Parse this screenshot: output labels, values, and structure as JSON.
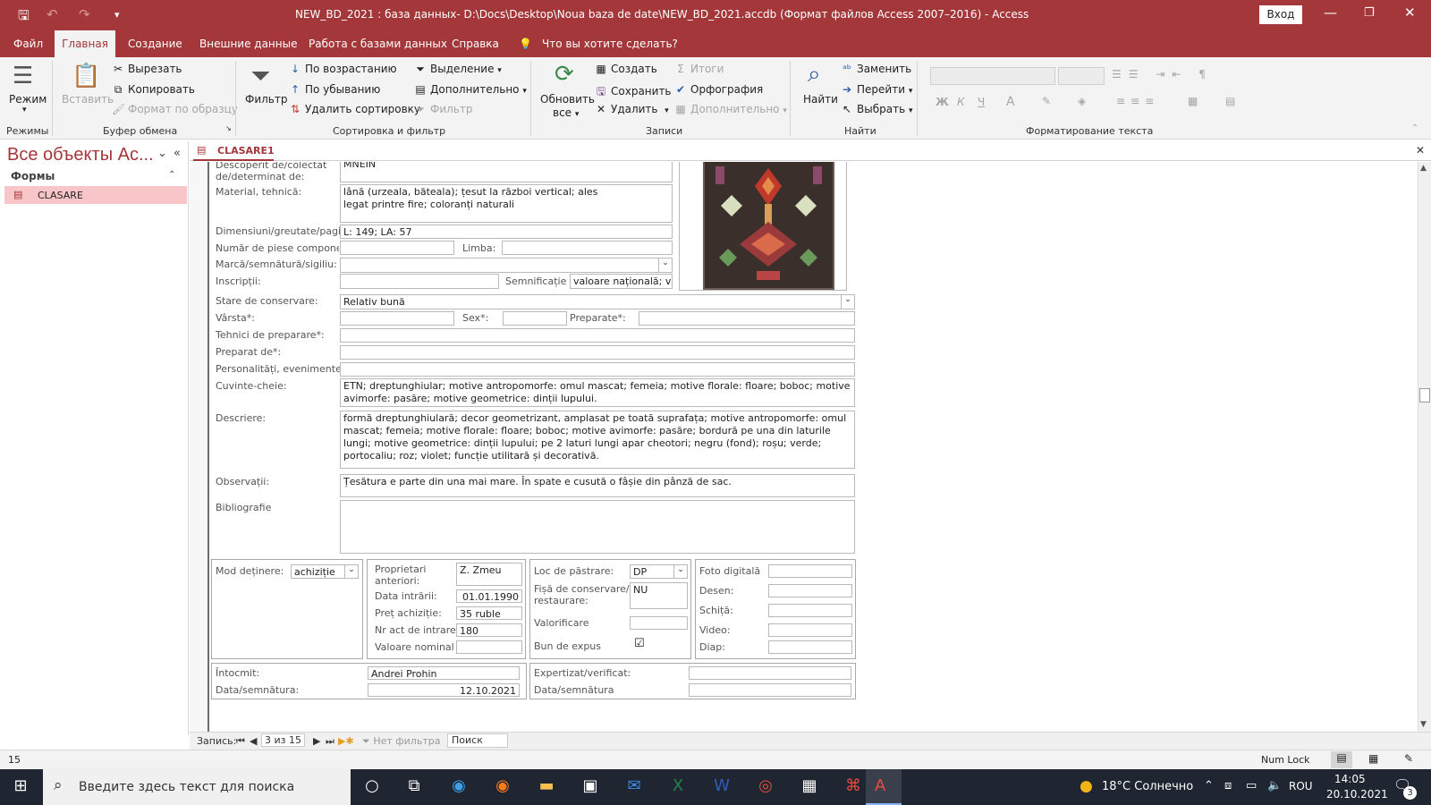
{
  "titlebar": {
    "title": "NEW_BD_2021 : база данных- D:\\Docs\\Desktop\\Noua baza de date\\NEW_BD_2021.accdb (Формат файлов Access 2007–2016)  -  Access",
    "login_label": "Вход"
  },
  "menu": {
    "tabs": [
      "Файл",
      "Главная",
      "Создание",
      "Внешние данные",
      "Работа с базами данных",
      "Справка"
    ],
    "tell_me": "Что вы хотите сделать?"
  },
  "ribbon": {
    "views": {
      "mode": "Режим",
      "group": "Режимы"
    },
    "clipboard": {
      "paste": "Вставить",
      "cut": "Вырезать",
      "copy": "Копировать",
      "format_painter": "Формат по образцу",
      "group": "Буфер обмена"
    },
    "sort_filter": {
      "filter": "Фильтр",
      "ascending": "По возрастанию",
      "descending": "По убыванию",
      "remove_sort": "Удалить сортировку",
      "selection": "Выделение",
      "advanced": "Дополнительно",
      "toggle_filter": "Фильтр",
      "group": "Сортировка и фильтр"
    },
    "records": {
      "refresh": "Обновить",
      "refresh2": "все",
      "new": "Создать",
      "save": "Сохранить",
      "delete": "Удалить",
      "totals": "Итоги",
      "spelling": "Орфография",
      "more": "Дополнительно",
      "group": "Записи"
    },
    "find": {
      "find": "Найти",
      "replace": "Заменить",
      "goto": "Перейти",
      "select": "Выбрать",
      "group": "Найти"
    },
    "text_format": {
      "group": "Форматирование текста"
    }
  },
  "nav": {
    "title": "Все объекты Ac...",
    "group": "Формы",
    "item": "CLASARE"
  },
  "doc": {
    "tab": "CLASARE1"
  },
  "form": {
    "descoperit_label": "Descoperit de/colectat de/determinat de:",
    "descoperit_value": "MNEIN",
    "material_label": "Material, tehnică:",
    "material_value": "lână (urzeala, băteala); țesut la război vertical; ales legat printre fire; coloranți naturali",
    "dimensiuni_label": "Dimensiuni/greutate/pagi",
    "dimensiuni_value": "L: 149; LA: 57",
    "numar_label": "Număr de piese componer",
    "limba_label": "Limba:",
    "marca_label": "Marcă/semnătură/sigiliu:",
    "inscriptii_label": "Inscripții:",
    "semnificatie_label": "Semnificație",
    "semnificatie_value": "valoare națională; va",
    "stare_label": "Stare de conservare:",
    "stare_value": "Relativ bună",
    "varsta_label": "Vârsta*:",
    "sex_label": "Sex*:",
    "preparate_label": "Preparate*:",
    "tehnici_label": "Tehnici de preparare*:",
    "preparat_label": "Preparat de*:",
    "personalitati_label": "Personalități, evenimente",
    "cuvinte_label": "Cuvinte-cheie:",
    "cuvinte_value": "ETN; dreptunghiular; motive antropomorfe: omul mascat; femeia; motive florale: floare; boboc; motive avimorfe: pasăre; motive geometrice: dinții lupului.",
    "descriere_label": "Descriere:",
    "descriere_value": "formă dreptunghiulară; decor geometrizant, amplasat pe toată suprafața; motive antropomorfe: omul mascat; femeia; motive florale: floare; boboc; motive avimorfe: pasăre; bordură pe una din laturile lungi; motive geometrice: dinții lupului; pe 2 laturi lungi apar cheotori; negru (fond); roșu; verde; portocaliu; roz; violet; funcție utilitară și decorativă.",
    "observatii_label": "Observații:",
    "observatii_value": "Țesătura e parte din una mai mare. În spate e cusută o fâșie din pânză de sac.",
    "bibliografie_label": "Bibliografie",
    "mod_label": "Mod deținere:",
    "mod_value": "achiziție",
    "proprietari_label": "Proprietari anteriori:",
    "proprietari_value": "Z. Zmeu",
    "data_intrarii_label": "Data intrării:",
    "data_intrarii_value": "01.01.1990",
    "pret_label": "Preț achiziție:",
    "pret_value": "35 ruble",
    "nr_act_label": "Nr act de intrare",
    "nr_act_value": "180",
    "valoare_label": "Valoare nominal",
    "loc_label": "Loc de păstrare:",
    "loc_value": "DP",
    "fisa_label": "Fișă de conservare/ restaurare:",
    "fisa_value": "NU",
    "valorificare_label": "Valorificare",
    "bun_label": "Bun de expus",
    "bun_value": "☑",
    "foto_label": "Foto digitală",
    "desen_label": "Desen:",
    "schita_label": "Schiță:",
    "video_label": "Video:",
    "diap_label": "Diap:",
    "intocmit_label": "Întocmit:",
    "intocmit_value": "Andrei Prohin",
    "data_semn_label": "Data/semnătura:",
    "data_semn_value": "12.10.2021",
    "expertizat_label": "Expertizat/verificat:",
    "data_semn2_label": "Data/semnătura"
  },
  "recnav": {
    "label": "Запись:",
    "position": "3 из 15",
    "filter": "Нет фильтра",
    "search": "Поиск"
  },
  "status": {
    "left": "15",
    "numlock": "Num Lock"
  },
  "taskbar": {
    "search_placeholder": "Введите здесь текст для поиска",
    "weather": "18°C  Солнечно",
    "lang": "ROU",
    "time": "14:05",
    "date": "20.10.2021",
    "notif_count": "3"
  },
  "colors": {
    "accent": "#a4373a",
    "nav_selected": "#f8c6c8",
    "taskbar": "#1f2531"
  }
}
